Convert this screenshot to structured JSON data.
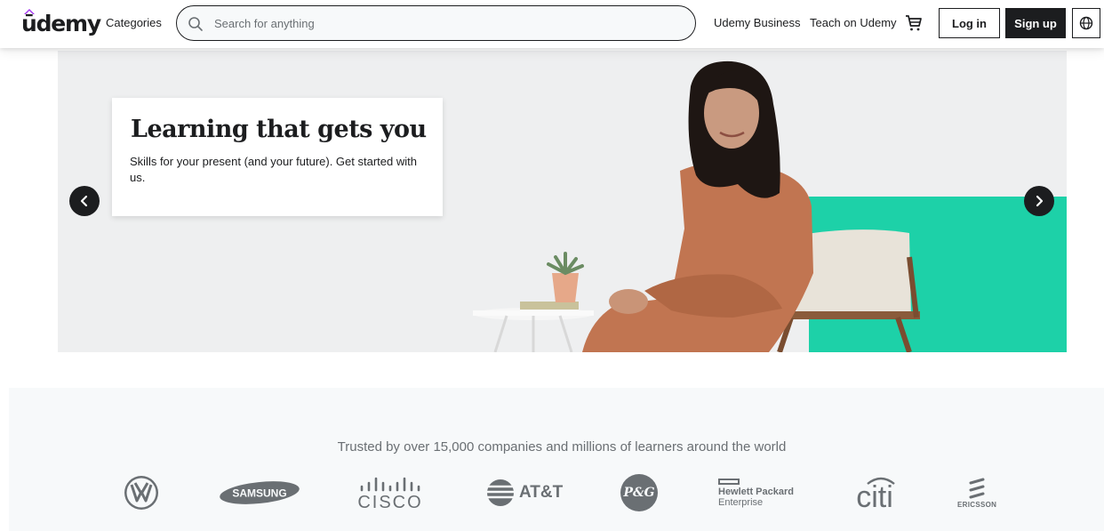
{
  "header": {
    "logo": "ūdemy",
    "categories": "Categories",
    "search_placeholder": "Search for anything",
    "business": "Udemy Business",
    "teach": "Teach on Udemy",
    "login": "Log in",
    "signup": "Sign up"
  },
  "hero": {
    "title": "Learning that gets you",
    "subtitle": "Skills for your present (and your future). Get started with us."
  },
  "trusted": {
    "text": "Trusted by over 15,000 companies and millions of learners around the world",
    "logos": {
      "vw": "VW",
      "samsung": "SAMSUNG",
      "cisco": "CISCO",
      "att": "AT&T",
      "pg": "P&G",
      "hpe_line1": "Hewlett Packard",
      "hpe_line2": "Enterprise",
      "citi": "citi",
      "ericsson": "ERICSSON"
    }
  },
  "colors": {
    "accent": "#a435f0",
    "dark": "#1c1d1f",
    "teal": "#1dd1a8",
    "hero_bg": "#eeeff0"
  }
}
